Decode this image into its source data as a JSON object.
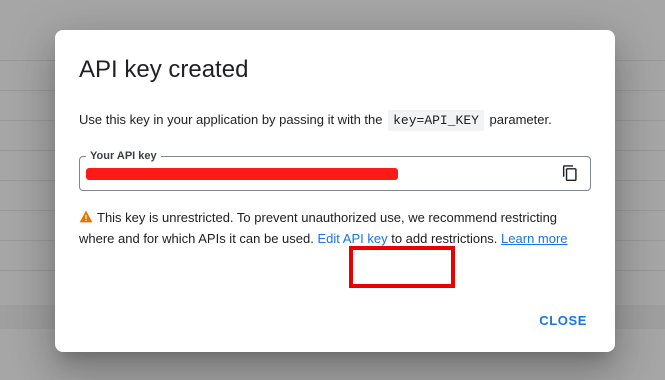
{
  "dialog": {
    "title": "API key created",
    "description": {
      "before": "Use this key in your application by passing it with the ",
      "code": "key=API_KEY",
      "after": " parameter."
    },
    "field": {
      "label": "Your API key",
      "value_redacted": true,
      "redaction_color": "#ff1a1a",
      "copy_icon": "copy-icon"
    },
    "warning": {
      "icon": "warning-triangle-icon",
      "icon_color": "#e37400",
      "text_part1": "This key is unrestricted. To prevent unauthorized use, we recommend restricting where and for which APIs it can be used.",
      "edit_link": "Edit API key",
      "text_part2": "to add restrictions.",
      "learn_more_link": "Learn more"
    },
    "close_label": "CLOSE"
  },
  "colors": {
    "accent": "#1a73e8",
    "highlight_box": "#ea0000",
    "overlay_background": "#a6a6a6"
  }
}
